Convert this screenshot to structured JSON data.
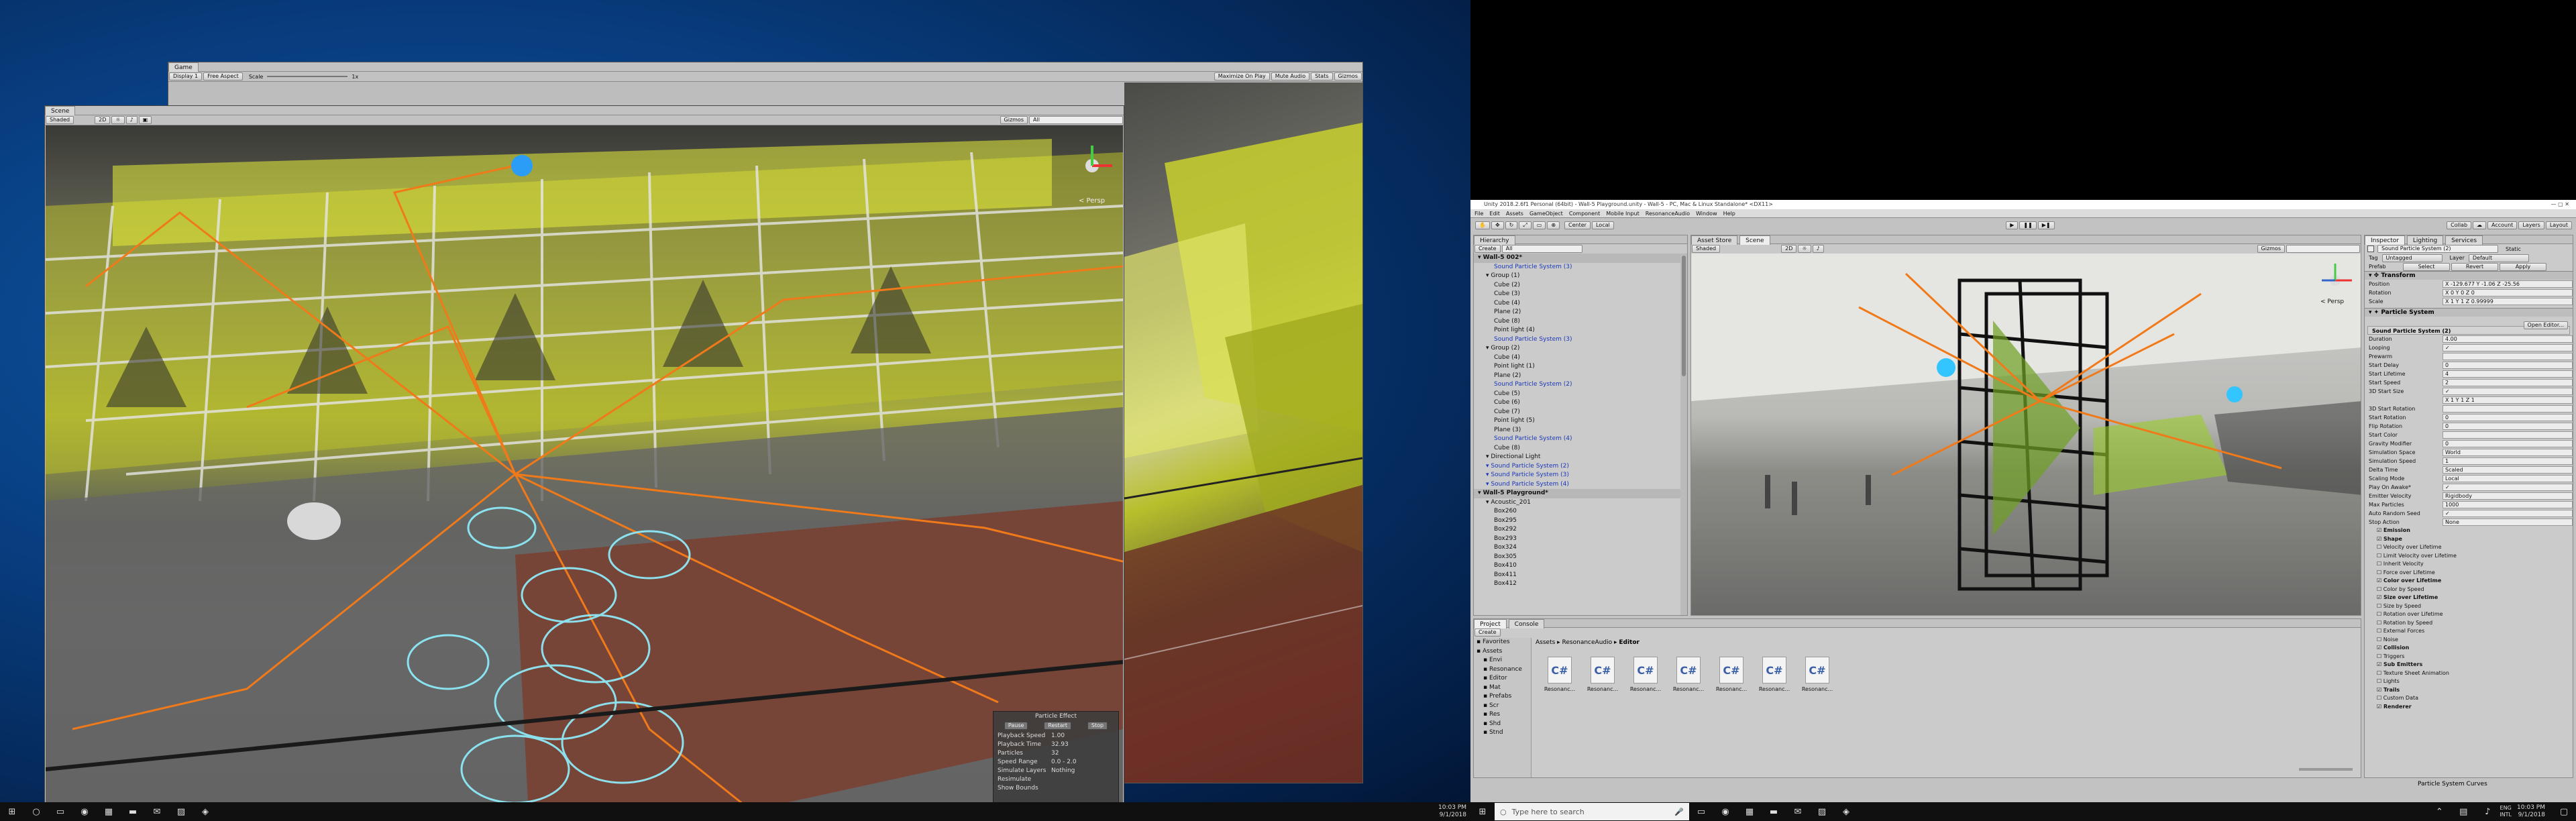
{
  "game_window": {
    "tab": "Game",
    "display": "Display 1",
    "aspect": "Free Aspect",
    "scale_label": "Scale",
    "scale_value": "1x",
    "buttons": [
      "Maximize On Play",
      "Mute Audio",
      "Stats",
      "Gizmos"
    ]
  },
  "scene_window": {
    "tab": "Scene",
    "shading": "Shaded",
    "mode_2d": "2D",
    "gizmos": "Gizmos",
    "search_placeholder": "All",
    "persp": "< Persp"
  },
  "particle_panel": {
    "title": "Particle Effect",
    "buttons": [
      "Pause",
      "Restart",
      "Stop"
    ],
    "rows": [
      {
        "label": "Playback Speed",
        "value": "1.00"
      },
      {
        "label": "Playback Time",
        "value": "32.93"
      },
      {
        "label": "Particles",
        "value": "32"
      },
      {
        "label": "Speed Range",
        "value": "0.0 - 2.0"
      },
      {
        "label": "Simulate Layers",
        "value": "Nothing"
      },
      {
        "label": "Resimulate",
        "value": ""
      },
      {
        "label": "Show Bounds",
        "value": ""
      }
    ]
  },
  "left_taskbar": {
    "time": "10:03 PM",
    "date": "9/1/2018"
  },
  "unity": {
    "title": "Unity 2018.2.6f1 Personal (64bit) - Wall-5 Playground.unity - Wall-5 - PC, Mac & Linux Standalone* <DX11>",
    "menu": [
      "File",
      "Edit",
      "Assets",
      "GameObject",
      "Component",
      "Mobile Input",
      "ResonanceAudio",
      "Window",
      "Help"
    ],
    "toolbar": {
      "center": "Center",
      "local": "Local",
      "collab": "Collab",
      "account": "Account",
      "layers": "Layers",
      "layout": "Layout"
    },
    "hierarchy": {
      "tab": "Hierarchy",
      "create": "Create",
      "search_placeholder": "All",
      "items": [
        {
          "text": "Wall-5 002*",
          "indent": 0,
          "style": "bold"
        },
        {
          "text": "Sound Particle System (3)",
          "indent": 2,
          "style": "blue"
        },
        {
          "text": "Group (1)",
          "indent": 1,
          "style": ""
        },
        {
          "text": "Cube (2)",
          "indent": 2,
          "style": ""
        },
        {
          "text": "Cube (3)",
          "indent": 2,
          "style": ""
        },
        {
          "text": "Cube (4)",
          "indent": 2,
          "style": ""
        },
        {
          "text": "Plane (2)",
          "indent": 2,
          "style": ""
        },
        {
          "text": "Cube (8)",
          "indent": 2,
          "style": ""
        },
        {
          "text": "Point light (4)",
          "indent": 2,
          "style": ""
        },
        {
          "text": "Sound Particle System (3)",
          "indent": 2,
          "style": "blue"
        },
        {
          "text": "Group (2)",
          "indent": 1,
          "style": ""
        },
        {
          "text": "Cube (4)",
          "indent": 2,
          "style": ""
        },
        {
          "text": "Point light (1)",
          "indent": 2,
          "style": ""
        },
        {
          "text": "Plane (2)",
          "indent": 2,
          "style": ""
        },
        {
          "text": "Sound Particle System (2)",
          "indent": 2,
          "style": "blue"
        },
        {
          "text": "Cube (5)",
          "indent": 2,
          "style": ""
        },
        {
          "text": "Cube (6)",
          "indent": 2,
          "style": ""
        },
        {
          "text": "Cube (7)",
          "indent": 2,
          "style": ""
        },
        {
          "text": "Point light (5)",
          "indent": 2,
          "style": ""
        },
        {
          "text": "Plane (3)",
          "indent": 2,
          "style": ""
        },
        {
          "text": "Sound Particle System (4)",
          "indent": 2,
          "style": "blue"
        },
        {
          "text": "Cube (8)",
          "indent": 2,
          "style": ""
        },
        {
          "text": "Directional Light",
          "indent": 1,
          "style": ""
        },
        {
          "text": "Sound Particle System (2)",
          "indent": 1,
          "style": "blue"
        },
        {
          "text": "Sound Particle System (3)",
          "indent": 1,
          "style": "blue"
        },
        {
          "text": "Sound Particle System (4)",
          "indent": 1,
          "style": "blue"
        },
        {
          "text": "Wall-5 Playground*",
          "indent": 0,
          "style": "bold"
        },
        {
          "text": "Acoustic_201",
          "indent": 1,
          "style": ""
        },
        {
          "text": "Box260",
          "indent": 2,
          "style": ""
        },
        {
          "text": "Box295",
          "indent": 2,
          "style": ""
        },
        {
          "text": "Box292",
          "indent": 2,
          "style": ""
        },
        {
          "text": "Box293",
          "indent": 2,
          "style": ""
        },
        {
          "text": "Box324",
          "indent": 2,
          "style": ""
        },
        {
          "text": "Box305",
          "indent": 2,
          "style": ""
        },
        {
          "text": "Box410",
          "indent": 2,
          "style": ""
        },
        {
          "text": "Box411",
          "indent": 2,
          "style": ""
        },
        {
          "text": "Box412",
          "indent": 2,
          "style": ""
        }
      ]
    },
    "scene_tabs": [
      "Asset Store",
      "Scene"
    ],
    "scene_toolbar": {
      "shading": "Shaded",
      "mode_2d": "2D",
      "gizmos": "Gizmos",
      "persp": "< Persp"
    },
    "project": {
      "tabs": [
        "Project",
        "Console"
      ],
      "create": "Create",
      "breadcrumb": [
        "Assets",
        "ResonanceAudio",
        "Editor"
      ],
      "tree": [
        "Favorites",
        "Assets",
        "Envi",
        "Resonance",
        "Editor",
        "Mat",
        "Prefabs",
        "Scr",
        "Res",
        "Shd",
        "Stnd"
      ],
      "assets": [
        "Resonanc...",
        "Resonanc...",
        "Resonanc...",
        "Resonanc...",
        "Resonanc...",
        "Resonanc...",
        "Resonanc..."
      ]
    },
    "inspector": {
      "tabs": [
        "Inspector",
        "Lighting",
        "Services"
      ],
      "object_name": "Sound Particle System (2)",
      "static": "Static",
      "tag_label": "Tag",
      "tag_value": "Untagged",
      "layer_label": "Layer",
      "layer_value": "Default",
      "prefab_label": "Prefab",
      "prefab_buttons": [
        "Select",
        "Revert",
        "Apply"
      ],
      "transform_title": "Transform",
      "transform_rows": [
        {
          "label": "Position",
          "value": "X -129.677   Y -1.06   Z -25.56"
        },
        {
          "label": "Rotation",
          "value": "X 0   Y 0   Z 0"
        },
        {
          "label": "Scale",
          "value": "X 1   Y 1   Z 0.99999"
        }
      ],
      "ps_title": "Particle System",
      "open_editor": "Open Editor...",
      "ps_sub": "Sound Particle System (2)",
      "ps_rows": [
        {
          "label": "Duration",
          "value": "4.00"
        },
        {
          "label": "Looping",
          "value": "✓"
        },
        {
          "label": "Prewarm",
          "value": ""
        },
        {
          "label": "Start Delay",
          "value": "0"
        },
        {
          "label": "Start Lifetime",
          "value": "4"
        },
        {
          "label": "Start Speed",
          "value": "2"
        },
        {
          "label": "3D Start Size",
          "value": "✓"
        },
        {
          "label": "",
          "value": "X 1   Y 1   Z 1"
        },
        {
          "label": "3D Start Rotation",
          "value": ""
        },
        {
          "label": "Start Rotation",
          "value": "0"
        },
        {
          "label": "Flip Rotation",
          "value": "0"
        },
        {
          "label": "Start Color",
          "value": ""
        },
        {
          "label": "Gravity Modifier",
          "value": "0"
        },
        {
          "label": "Simulation Space",
          "value": "World"
        },
        {
          "label": "Simulation Speed",
          "value": "1"
        },
        {
          "label": "Delta Time",
          "value": "Scaled"
        },
        {
          "label": "Scaling Mode",
          "value": "Local"
        },
        {
          "label": "Play On Awake*",
          "value": "✓"
        },
        {
          "label": "Emitter Velocity",
          "value": "Rigidbody"
        },
        {
          "label": "Max Particles",
          "value": "1000"
        },
        {
          "label": "Auto Random Seed",
          "value": "✓"
        },
        {
          "label": "Stop Action",
          "value": "None"
        }
      ],
      "modules": [
        {
          "text": "Emission",
          "bold": true
        },
        {
          "text": "Shape",
          "bold": true
        },
        {
          "text": "Velocity over Lifetime",
          "bold": false
        },
        {
          "text": "Limit Velocity over Lifetime",
          "bold": false
        },
        {
          "text": "Inherit Velocity",
          "bold": false
        },
        {
          "text": "Force over Lifetime",
          "bold": false
        },
        {
          "text": "Color over Lifetime",
          "bold": true
        },
        {
          "text": "Color by Speed",
          "bold": false
        },
        {
          "text": "Size over Lifetime",
          "bold": true
        },
        {
          "text": "Size by Speed",
          "bold": false
        },
        {
          "text": "Rotation over Lifetime",
          "bold": false
        },
        {
          "text": "Rotation by Speed",
          "bold": false
        },
        {
          "text": "External Forces",
          "bold": false
        },
        {
          "text": "Noise",
          "bold": false
        },
        {
          "text": "Collision",
          "bold": true
        },
        {
          "text": "Triggers",
          "bold": false
        },
        {
          "text": "Sub Emitters",
          "bold": true
        },
        {
          "text": "Texture Sheet Animation",
          "bold": false
        },
        {
          "text": "Lights",
          "bold": false
        },
        {
          "text": "Trails",
          "bold": true
        },
        {
          "text": "Custom Data",
          "bold": false
        },
        {
          "text": "Renderer",
          "bold": true
        }
      ],
      "curves_label": "Particle System Curves"
    }
  },
  "right_taskbar": {
    "search_placeholder": "Type here to search",
    "lang": "ENG",
    "locale": "INTL",
    "time": "10:03 PM",
    "date": "9/1/2018"
  }
}
